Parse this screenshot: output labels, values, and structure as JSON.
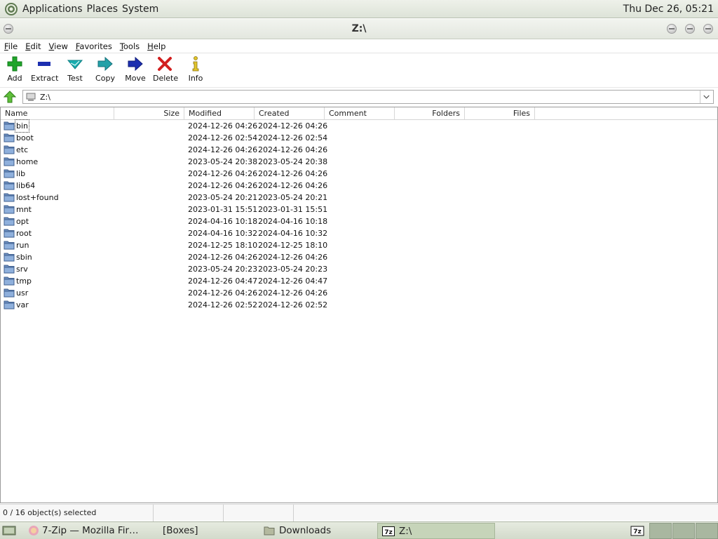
{
  "top_panel": {
    "menus": [
      "Applications",
      "Places",
      "System"
    ],
    "clock": "Thu Dec 26, 05:21"
  },
  "window": {
    "title": "Z:\\"
  },
  "menubar": [
    {
      "accel": "F",
      "rest": "ile"
    },
    {
      "accel": "E",
      "rest": "dit"
    },
    {
      "accel": "V",
      "rest": "iew"
    },
    {
      "accel": "F",
      "rest": "avorites"
    },
    {
      "accel": "T",
      "rest": "ools"
    },
    {
      "accel": "H",
      "rest": "elp"
    }
  ],
  "toolbar": {
    "add": "Add",
    "extract": "Extract",
    "test": "Test",
    "copy": "Copy",
    "move": "Move",
    "delete": "Delete",
    "info": "Info"
  },
  "address": {
    "value": "Z:\\"
  },
  "columns": [
    "Name",
    "Size",
    "Modified",
    "Created",
    "Comment",
    "Folders",
    "Files"
  ],
  "rows": [
    {
      "name": "bin",
      "size": "",
      "modified": "2024-12-26 04:26",
      "created": "2024-12-26 04:26"
    },
    {
      "name": "boot",
      "size": "",
      "modified": "2024-12-26 02:54",
      "created": "2024-12-26 02:54"
    },
    {
      "name": "etc",
      "size": "",
      "modified": "2024-12-26 04:26",
      "created": "2024-12-26 04:26"
    },
    {
      "name": "home",
      "size": "",
      "modified": "2023-05-24 20:38",
      "created": "2023-05-24 20:38"
    },
    {
      "name": "lib",
      "size": "",
      "modified": "2024-12-26 04:26",
      "created": "2024-12-26 04:26"
    },
    {
      "name": "lib64",
      "size": "",
      "modified": "2024-12-26 04:26",
      "created": "2024-12-26 04:26"
    },
    {
      "name": "lost+found",
      "size": "",
      "modified": "2023-05-24 20:21",
      "created": "2023-05-24 20:21"
    },
    {
      "name": "mnt",
      "size": "",
      "modified": "2023-01-31 15:51",
      "created": "2023-01-31 15:51"
    },
    {
      "name": "opt",
      "size": "",
      "modified": "2024-04-16 10:18",
      "created": "2024-04-16 10:18"
    },
    {
      "name": "root",
      "size": "",
      "modified": "2024-04-16 10:32",
      "created": "2024-04-16 10:32"
    },
    {
      "name": "run",
      "size": "",
      "modified": "2024-12-25 18:10",
      "created": "2024-12-25 18:10"
    },
    {
      "name": "sbin",
      "size": "",
      "modified": "2024-12-26 04:26",
      "created": "2024-12-26 04:26"
    },
    {
      "name": "srv",
      "size": "",
      "modified": "2023-05-24 20:23",
      "created": "2023-05-24 20:23"
    },
    {
      "name": "tmp",
      "size": "",
      "modified": "2024-12-26 04:47",
      "created": "2024-12-26 04:47"
    },
    {
      "name": "usr",
      "size": "",
      "modified": "2024-12-26 04:26",
      "created": "2024-12-26 04:26"
    },
    {
      "name": "var",
      "size": "",
      "modified": "2024-12-26 02:52",
      "created": "2024-12-26 02:52"
    }
  ],
  "status": {
    "selection": "0 / 16 object(s) selected"
  },
  "taskbar": {
    "tasks": [
      "7-Zip — Mozilla Fir…",
      "[Boxes]",
      "Downloads",
      "Z:\\"
    ],
    "active_index": 3
  },
  "colors": {
    "folder": "#6d8fbf",
    "add_green": "#1fa52a",
    "extract_blue": "#1c2fb0",
    "test_cyan": "#1aaeb0",
    "delete_red": "#d21f1f",
    "info_yellow": "#e2c52a"
  },
  "icons": {
    "add": "plus-icon",
    "extract": "minus-icon",
    "test": "checkmark-icon",
    "copy": "arrow-right-icon",
    "move": "arrow-right-icon",
    "delete": "x-icon",
    "info": "info-icon",
    "up": "up-arrow-icon",
    "folder": "folder-icon"
  }
}
